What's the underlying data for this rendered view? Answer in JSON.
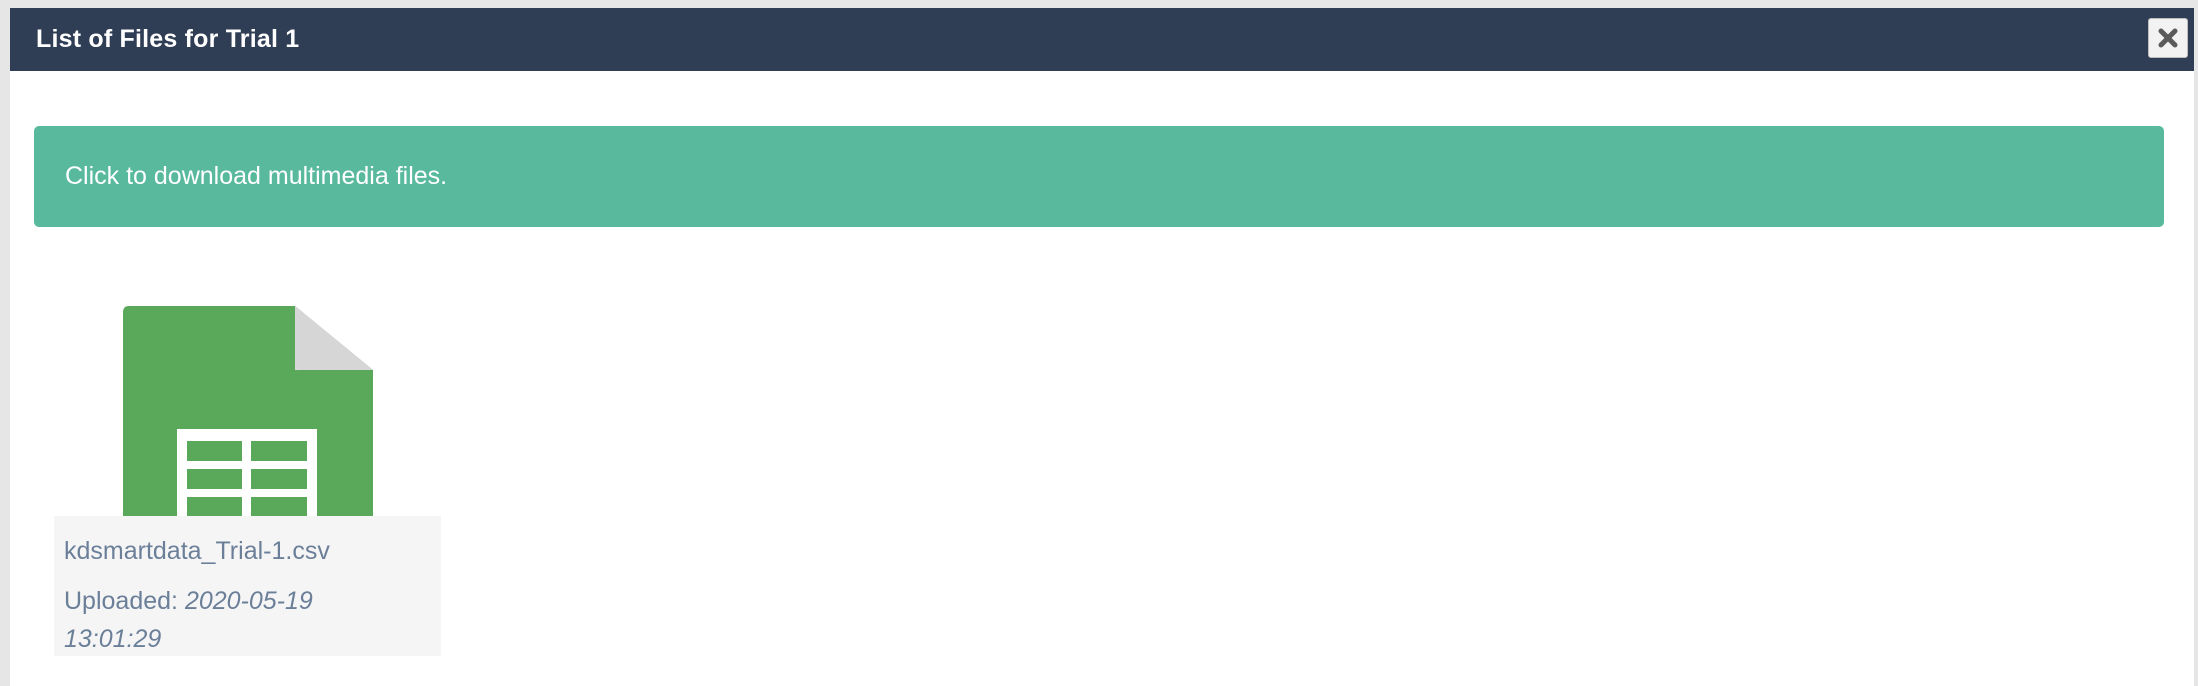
{
  "dialog": {
    "title": "List of Files for Trial 1",
    "close_icon": "close-icon"
  },
  "alert": {
    "text": "Click to download multimedia files.",
    "color": "#59b99d"
  },
  "files": [
    {
      "icon": "spreadsheet-file-icon",
      "icon_color": "#5aa95a",
      "name": "kdsmartdata_Trial-1.csv",
      "uploaded_label": "Uploaded:",
      "uploaded_date": "2020-05-19 13:01:29"
    }
  ],
  "colors": {
    "titlebar": "#2f3d55",
    "caption_text": "#6b7f99"
  }
}
